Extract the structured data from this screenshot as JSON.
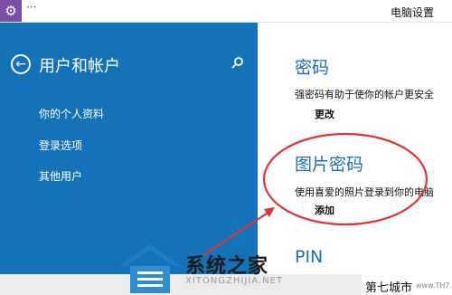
{
  "titlebar": {
    "app_icon": "gear-icon",
    "menu": "···",
    "title": "电脑设置"
  },
  "sidebar": {
    "back_icon": "back-arrow-icon",
    "title": "用户和帐户",
    "search_icon": "search-icon",
    "items": [
      {
        "label": "你的个人资料"
      },
      {
        "label": "登录选项"
      },
      {
        "label": "其他用户"
      }
    ]
  },
  "main": {
    "password": {
      "title": "密码",
      "description": "强密码有助于使你的帐户更安全",
      "action": "更改"
    },
    "picture_password": {
      "title": "图片密码",
      "description": "使用喜爱的照片登录到你的电脑",
      "action": "添加"
    },
    "pin": {
      "title": "PIN"
    }
  },
  "watermark": {
    "brand_cn": "系统之家",
    "brand_en": "XITONGZHIJIA.NET",
    "site_cn": "第七城市",
    "site_url": "www.TH7.cn"
  },
  "colors": {
    "sidebar_bg": "#1472b8",
    "accent_title": "#1a6fb5",
    "annotation": "#d9373b",
    "app_icon_bg": "#7a4fa8"
  }
}
